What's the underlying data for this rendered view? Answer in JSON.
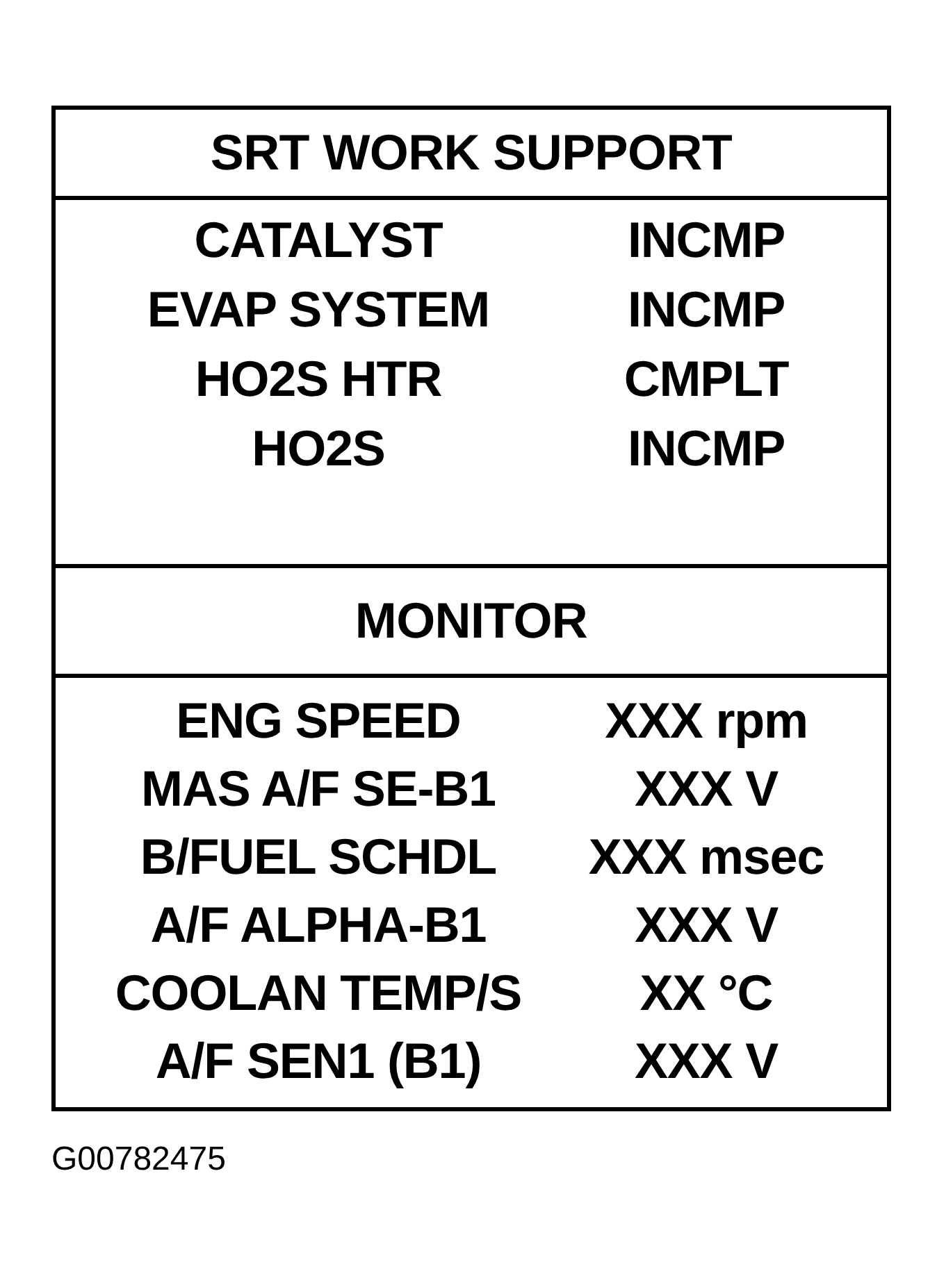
{
  "sections": [
    {
      "title": "SRT WORK SUPPORT",
      "rows": [
        {
          "label": "CATALYST",
          "value": "INCMP"
        },
        {
          "label": "EVAP SYSTEM",
          "value": "INCMP"
        },
        {
          "label": "HO2S HTR",
          "value": "CMPLT"
        },
        {
          "label": "HO2S",
          "value": "INCMP"
        }
      ]
    },
    {
      "title": "MONITOR",
      "rows": [
        {
          "label": "ENG SPEED",
          "value": "XXX rpm"
        },
        {
          "label": "MAS A/F SE-B1",
          "value": "XXX V"
        },
        {
          "label": "B/FUEL SCHDL",
          "value": "XXX msec"
        },
        {
          "label": "A/F ALPHA-B1",
          "value": "XXX V"
        },
        {
          "label": "COOLAN TEMP/S",
          "value": "XX °C"
        },
        {
          "label": "A/F SEN1 (B1)",
          "value": "XXX V"
        }
      ]
    }
  ],
  "figure_code": "G00782475"
}
